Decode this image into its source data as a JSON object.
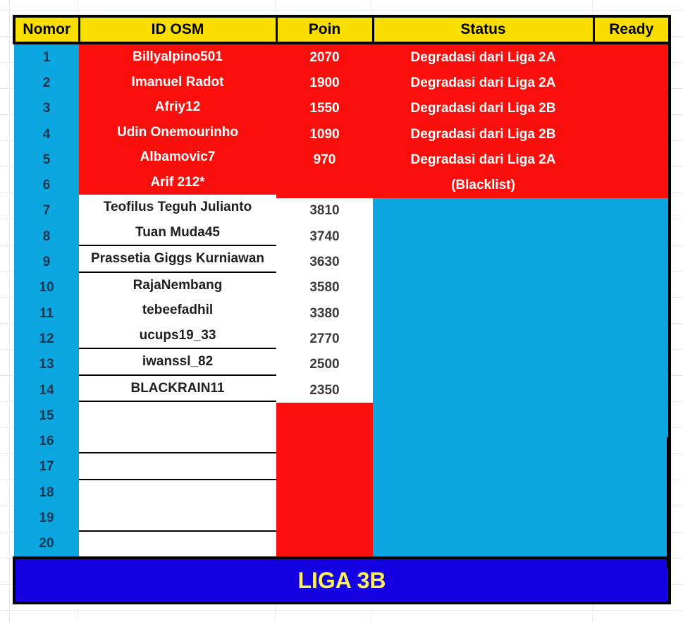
{
  "sheet": {
    "background_color": "#ffffff",
    "gridline_color": "#e9e9e9"
  },
  "table": {
    "name": "liga-3b-standings",
    "colors": {
      "header_fill": "#F9DF00",
      "header_text": "#000000",
      "nomor_fill": "#0CA7E0",
      "red_fill": "#FA0F0C",
      "cyan_fill": "#0CA7E0",
      "white_fill": "#FFFFFF",
      "banner_fill": "#1400E0",
      "banner_text": "#FAF15E",
      "border": "#000000"
    },
    "headers": [
      {
        "key": "nomor",
        "label": "Nomor"
      },
      {
        "key": "id_osm",
        "label": "ID OSM"
      },
      {
        "key": "poin",
        "label": "Poin"
      },
      {
        "key": "status",
        "label": "Status"
      },
      {
        "key": "ready",
        "label": "Ready"
      }
    ],
    "rows": [
      {
        "nomor": "1",
        "id_osm": "Billyalpino501",
        "poin": "2070",
        "status": "Degradasi dari Liga 2A",
        "ready": ""
      },
      {
        "nomor": "2",
        "id_osm": "Imanuel Radot",
        "poin": "1900",
        "status": "Degradasi dari Liga 2A",
        "ready": ""
      },
      {
        "nomor": "3",
        "id_osm": "Afriy12",
        "poin": "1550",
        "status": "Degradasi dari Liga 2B",
        "ready": ""
      },
      {
        "nomor": "4",
        "id_osm": "Udin Onemourinho",
        "poin": "1090",
        "status": "Degradasi dari Liga 2B",
        "ready": ""
      },
      {
        "nomor": "5",
        "id_osm": "Albamovic7",
        "poin": "970",
        "status": "Degradasi dari Liga 2A",
        "ready": ""
      },
      {
        "nomor": "6",
        "id_osm": "Arif 212*",
        "poin": "",
        "status": "(Blacklist)",
        "ready": ""
      },
      {
        "nomor": "7",
        "id_osm": "Teofilus Teguh Julianto",
        "poin": "3810",
        "status": "",
        "ready": ""
      },
      {
        "nomor": "8",
        "id_osm": "Tuan Muda45",
        "poin": "3740",
        "status": "",
        "ready": ""
      },
      {
        "nomor": "9",
        "id_osm": "Prassetia Giggs Kurniawan",
        "poin": "3630",
        "status": "",
        "ready": ""
      },
      {
        "nomor": "10",
        "id_osm": "RajaNembang",
        "poin": "3580",
        "status": "",
        "ready": ""
      },
      {
        "nomor": "11",
        "id_osm": "tebeefadhil",
        "poin": "3380",
        "status": "",
        "ready": ""
      },
      {
        "nomor": "12",
        "id_osm": "ucups19_33",
        "poin": "2770",
        "status": "",
        "ready": ""
      },
      {
        "nomor": "13",
        "id_osm": "iwanssl_82",
        "poin": "2500",
        "status": "",
        "ready": ""
      },
      {
        "nomor": "14",
        "id_osm": "BLACKRAIN11",
        "poin": "2350",
        "status": "",
        "ready": ""
      },
      {
        "nomor": "15",
        "id_osm": "",
        "poin": "",
        "status": "",
        "ready": ""
      },
      {
        "nomor": "16",
        "id_osm": "",
        "poin": "",
        "status": "",
        "ready": ""
      },
      {
        "nomor": "17",
        "id_osm": "",
        "poin": "",
        "status": "",
        "ready": ""
      },
      {
        "nomor": "18",
        "id_osm": "",
        "poin": "",
        "status": "",
        "ready": ""
      },
      {
        "nomor": "19",
        "id_osm": "",
        "poin": "",
        "status": "",
        "ready": ""
      },
      {
        "nomor": "20",
        "id_osm": "",
        "poin": "",
        "status": "",
        "ready": ""
      }
    ]
  },
  "banner": {
    "label": "LIGA 3B"
  }
}
